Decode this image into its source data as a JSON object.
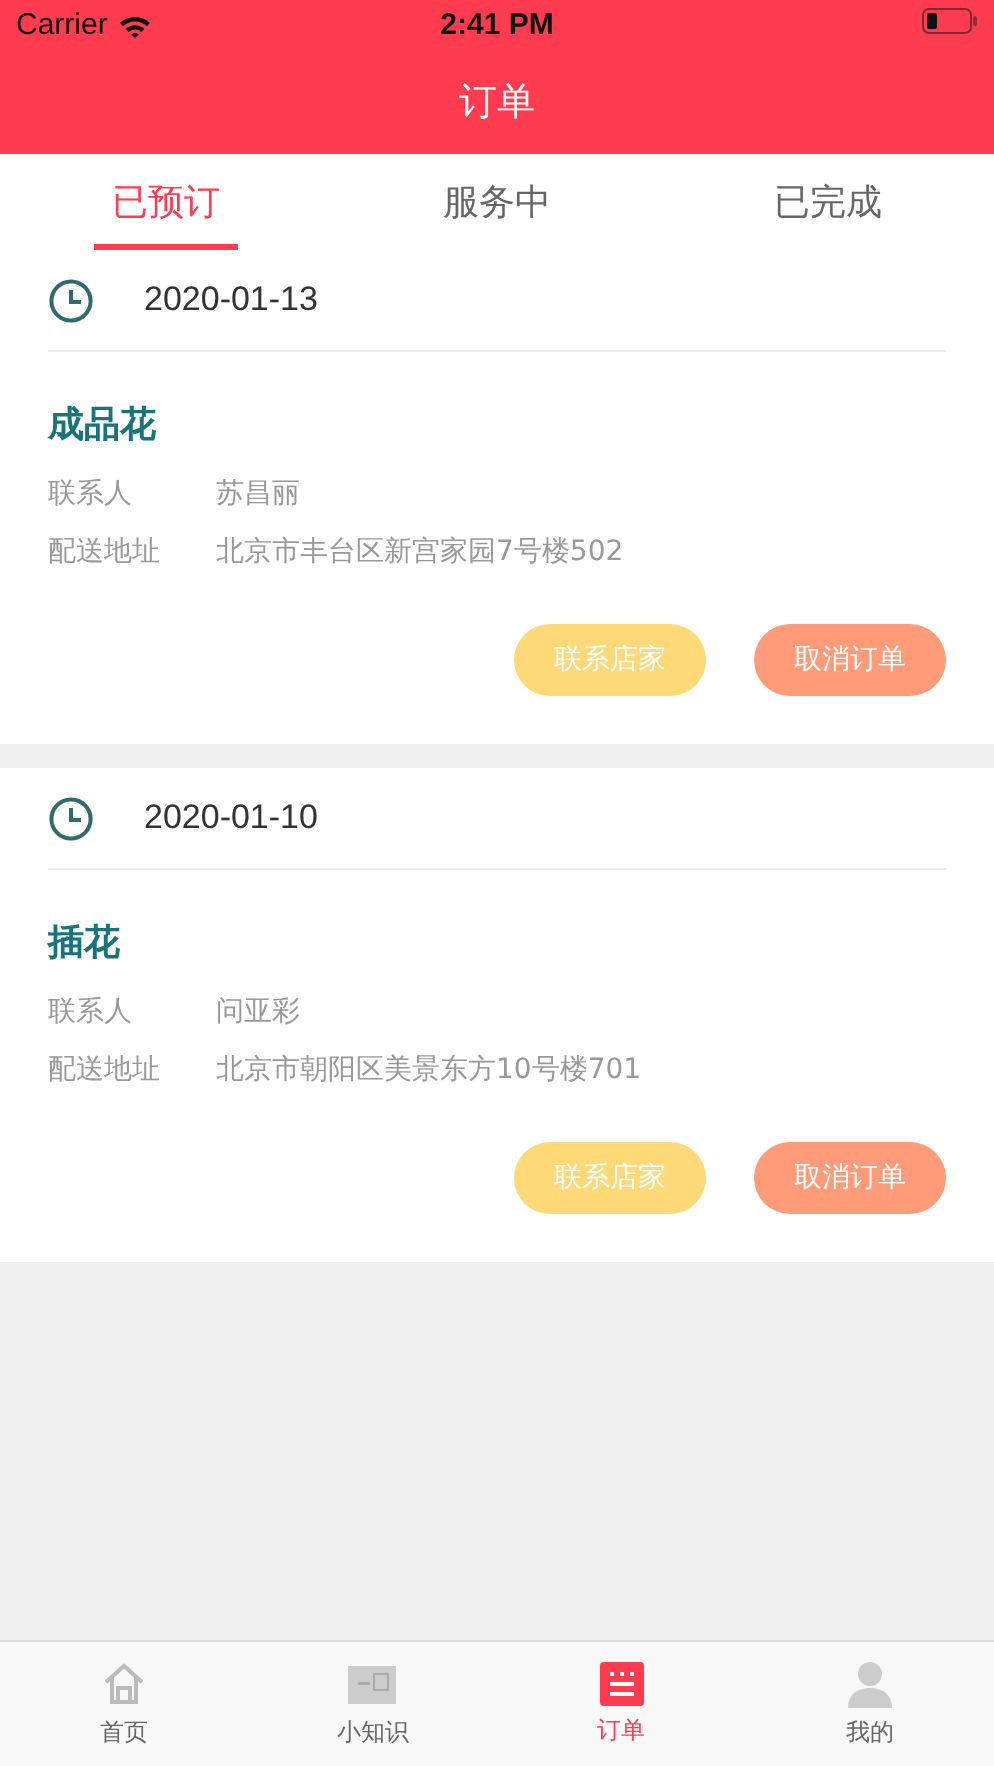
{
  "status_bar": {
    "carrier": "Carrier",
    "time": "2:41 PM"
  },
  "nav": {
    "title": "订单"
  },
  "tabs": [
    {
      "label": "已预订",
      "selected": true
    },
    {
      "label": "服务中",
      "selected": false
    },
    {
      "label": "已完成",
      "selected": false
    }
  ],
  "orders": [
    {
      "date": "2020-01-13",
      "product": "成品花",
      "contact_label": "联系人",
      "contact": "苏昌丽",
      "address_label": "配送地址",
      "address": "北京市丰台区新宫家园7号楼502",
      "buttons": [
        "联系店家",
        "取消订单"
      ]
    },
    {
      "date": "2020-01-10",
      "product": "插花",
      "contact_label": "联系人",
      "contact": "问亚彩",
      "address_label": "配送地址",
      "address": "北京市朝阳区美景东方10号楼701",
      "buttons": [
        "联系店家",
        "取消订单"
      ]
    }
  ],
  "tab_bar": [
    {
      "kind": "home",
      "label": "首页",
      "selected": false
    },
    {
      "kind": "knowledge",
      "label": "小知识",
      "selected": false
    },
    {
      "kind": "orders",
      "label": "订单",
      "selected": true
    },
    {
      "kind": "profile",
      "label": "我的",
      "selected": false
    }
  ]
}
